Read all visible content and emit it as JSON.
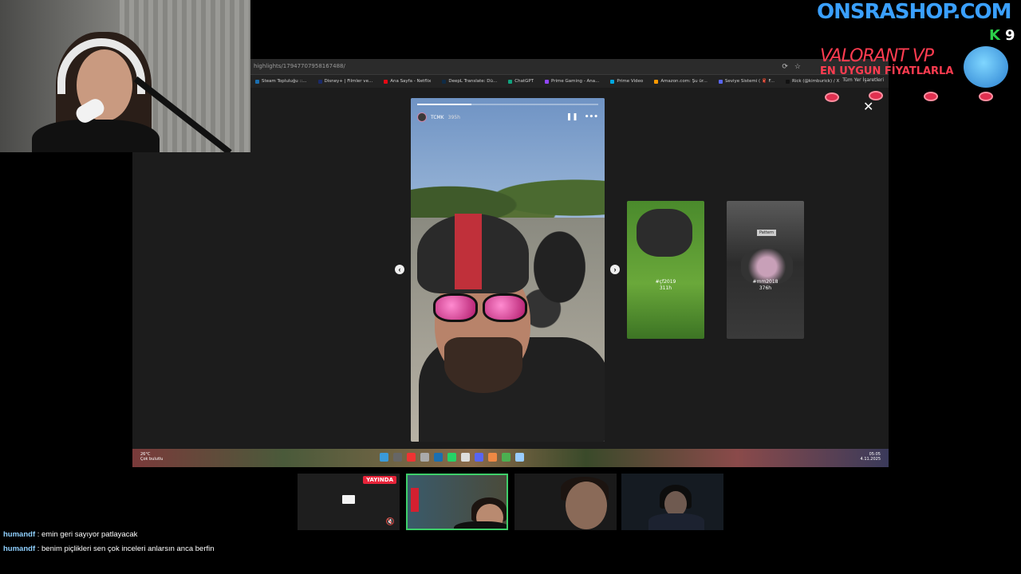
{
  "browser": {
    "url": "highlights/17947707958167488/",
    "bookmarks": [
      {
        "label": "Steam Topluluğu ::...",
        "color": "#1b6fb0"
      },
      {
        "label": "Disney+ | Filmler ve...",
        "color": "#1a2a6a"
      },
      {
        "label": "Ana Sayfa - Netflix",
        "color": "#e50914"
      },
      {
        "label": "DeepL Translate: Dü...",
        "color": "#0f2b46"
      },
      {
        "label": "ChatGPT",
        "color": "#10a37f"
      },
      {
        "label": "Prime Gaming - Ana...",
        "color": "#9146ff"
      },
      {
        "label": "Prime Video",
        "color": "#00a8e1"
      },
      {
        "label": "Amazon.com: Şu ür...",
        "color": "#ff9900"
      },
      {
        "label": "Seviye Sistemi ( 🧣 F...",
        "color": "#5865f2"
      },
      {
        "label": "Rick (@kimburick) / X",
        "color": "#111111"
      }
    ],
    "bookmarks_more": "Tüm Yer İşaretleri"
  },
  "story": {
    "username": "TCMK",
    "time": "395h",
    "progress": 0.3
  },
  "side_stories": [
    {
      "tag": "#çf2019",
      "time": "311h"
    },
    {
      "tag": "#mm2018",
      "time": "376h",
      "sticker": "Pattern"
    }
  ],
  "taskbar": {
    "temperature": "26°C",
    "weather": "Çok bulutlu",
    "time": "05:05",
    "date": "4.11.2025",
    "icon_colors": [
      "#3a9ad9",
      "#666",
      "#e33",
      "#aaa",
      "#1b6fb0",
      "#25d366",
      "#ddd",
      "#5865f2",
      "#e84",
      "#4caf50",
      "#9cf"
    ]
  },
  "sponsor": {
    "site": "ONSRASHOP.COM",
    "k_letter": "K",
    "k_number": "9",
    "game": "VALORANT VP",
    "tagline": "EN UYGUN FİYATLARLA"
  },
  "live_badge": "YAYINDA",
  "chat": [
    {
      "user": "humandf",
      "text": " : emin geri sayıyor patlayacak"
    },
    {
      "user": "humandf",
      "text": " : benim piçlikleri sen çok inceleri anlarsın anca berfin"
    }
  ]
}
